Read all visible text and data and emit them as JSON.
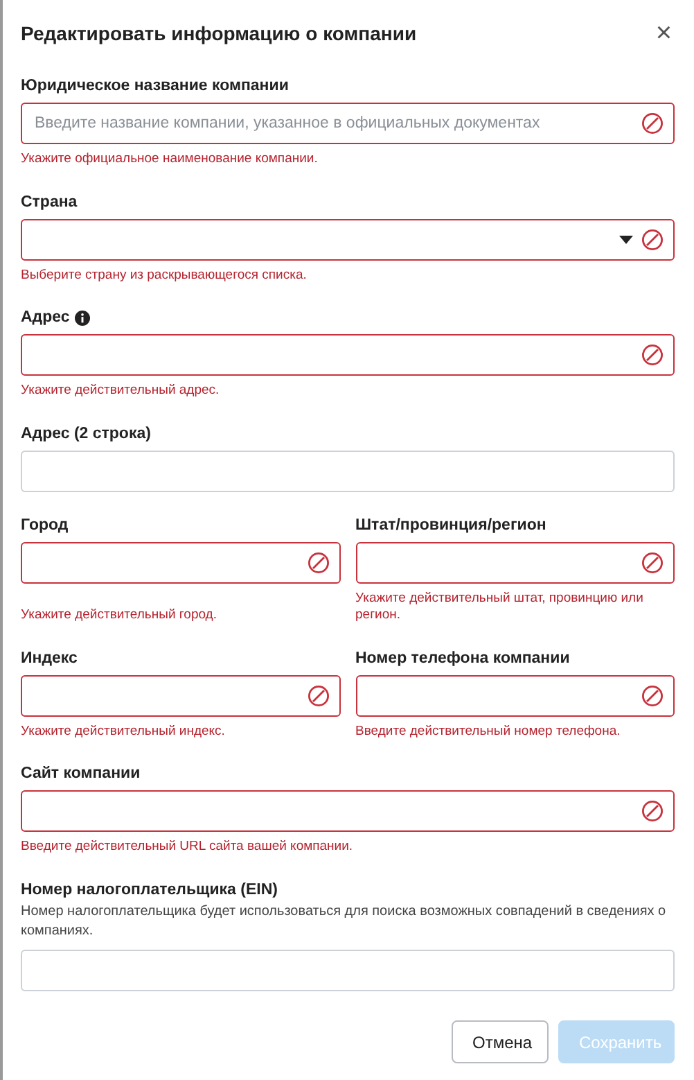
{
  "dialog": {
    "title": "Редактировать информацию о компании",
    "close": "×"
  },
  "rows": [
    {
      "fields": [
        {
          "kind": "text",
          "label": "Юридическое название компании",
          "info": false,
          "placeholder": "Введите название компании, указанное в официальных документах",
          "invalid": true,
          "error": "Укажите официальное наименование компании."
        }
      ]
    },
    {
      "fields": [
        {
          "kind": "select",
          "label": "Страна",
          "info": false,
          "invalid": true,
          "error": "Выберите страну из раскрывающегося списка."
        }
      ]
    },
    {
      "fields": [
        {
          "kind": "text",
          "label": "Адрес",
          "info": true,
          "invalid": true,
          "error": "Укажите действительный адрес."
        }
      ]
    },
    {
      "fields": [
        {
          "kind": "text",
          "label": "Адрес (2 строка)",
          "info": false,
          "invalid": false
        }
      ]
    },
    {
      "fields": [
        {
          "kind": "text",
          "label": "Город",
          "info": false,
          "invalid": true,
          "error": "Укажите действительный город."
        },
        {
          "kind": "text",
          "label": "Штат/провинция/регион",
          "info": false,
          "invalid": true,
          "error": "Укажите действительный штат, провинцию или регион."
        }
      ]
    },
    {
      "fields": [
        {
          "kind": "text",
          "label": "Индекс",
          "info": false,
          "invalid": true,
          "error": "Укажите действительный индекс."
        },
        {
          "kind": "text",
          "label": "Номер телефона компании",
          "info": false,
          "invalid": true,
          "error": "Введите действительный номер телефона."
        }
      ]
    },
    {
      "fields": [
        {
          "kind": "text",
          "label": "Сайт компании",
          "info": false,
          "invalid": true,
          "error": "Введите действительный URL сайта вашей компании."
        }
      ]
    },
    {
      "fields": [
        {
          "kind": "text",
          "label": "Номер налогоплательщика (EIN)",
          "info": false,
          "hint": "Номер налогоплательщика будет использоваться для поиска возможных совпадений в сведениях о компаниях.",
          "invalid": false
        }
      ]
    }
  ],
  "buttons": [
    {
      "label": "Отмена",
      "kind": "secondary",
      "disabled": false
    },
    {
      "label": "Сохранить",
      "kind": "primary",
      "disabled": true
    }
  ]
}
